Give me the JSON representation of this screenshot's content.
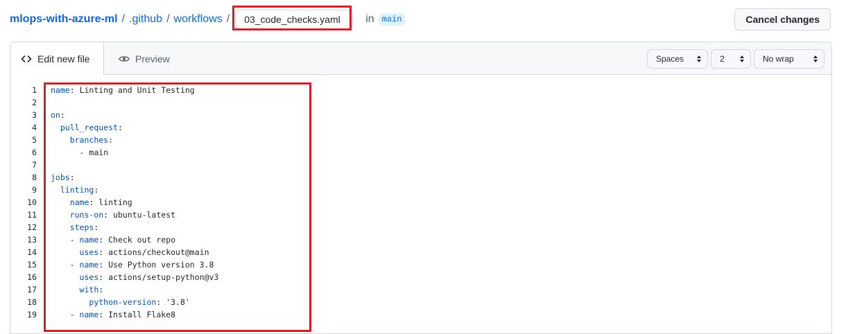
{
  "breadcrumb": {
    "repo": "mlops-with-azure-ml",
    "separator": "/",
    "folder1": ".github",
    "folder2": "workflows",
    "filename": "03_code_checks.yaml",
    "in_label": "in",
    "branch": "main"
  },
  "header": {
    "cancel_label": "Cancel changes"
  },
  "tabs": {
    "edit_label": "Edit new file",
    "preview_label": "Preview"
  },
  "options": {
    "indent_mode": "Spaces",
    "indent_size": "2",
    "wrap_mode": "No wrap"
  },
  "code_lines": [
    {
      "n": "1",
      "key": "name",
      "indent": "",
      "val": " Linting and Unit Testing"
    },
    {
      "n": "2",
      "key": "",
      "indent": "",
      "val": ""
    },
    {
      "n": "3",
      "key": "on",
      "indent": "",
      "val": ""
    },
    {
      "n": "4",
      "key": "pull_request",
      "indent": "  ",
      "val": ""
    },
    {
      "n": "5",
      "key": "branches",
      "indent": "    ",
      "val": ""
    },
    {
      "n": "6",
      "key": "",
      "indent": "      ",
      "val": "- main"
    },
    {
      "n": "7",
      "key": "",
      "indent": "",
      "val": ""
    },
    {
      "n": "8",
      "key": "jobs",
      "indent": "",
      "val": ""
    },
    {
      "n": "9",
      "key": "linting",
      "indent": "  ",
      "val": ""
    },
    {
      "n": "10",
      "key": "name",
      "indent": "    ",
      "val": " linting"
    },
    {
      "n": "11",
      "key": "runs-on",
      "indent": "    ",
      "val": " ubuntu-latest"
    },
    {
      "n": "12",
      "key": "steps",
      "indent": "    ",
      "val": ""
    },
    {
      "n": "13",
      "key": "name",
      "indent": "    - ",
      "val": " Check out repo"
    },
    {
      "n": "14",
      "key": "uses",
      "indent": "      ",
      "val": " actions/checkout@main"
    },
    {
      "n": "15",
      "key": "name",
      "indent": "    - ",
      "val": " Use Python version 3.8"
    },
    {
      "n": "16",
      "key": "uses",
      "indent": "      ",
      "val": " actions/setup-python@v3"
    },
    {
      "n": "17",
      "key": "with",
      "indent": "      ",
      "val": ""
    },
    {
      "n": "18",
      "key": "python-version",
      "indent": "        ",
      "val": " '3.8'"
    },
    {
      "n": "19",
      "key": "name",
      "indent": "    - ",
      "val": " Install Flake8"
    }
  ],
  "colors": {
    "link": "#0969da",
    "yaml_key": "#0550ae",
    "highlight_box": "#d32028"
  },
  "icons": {
    "edit_tab": "code-brackets-icon",
    "preview_tab": "eye-icon",
    "select_arrows": "up-down-arrows-icon"
  }
}
